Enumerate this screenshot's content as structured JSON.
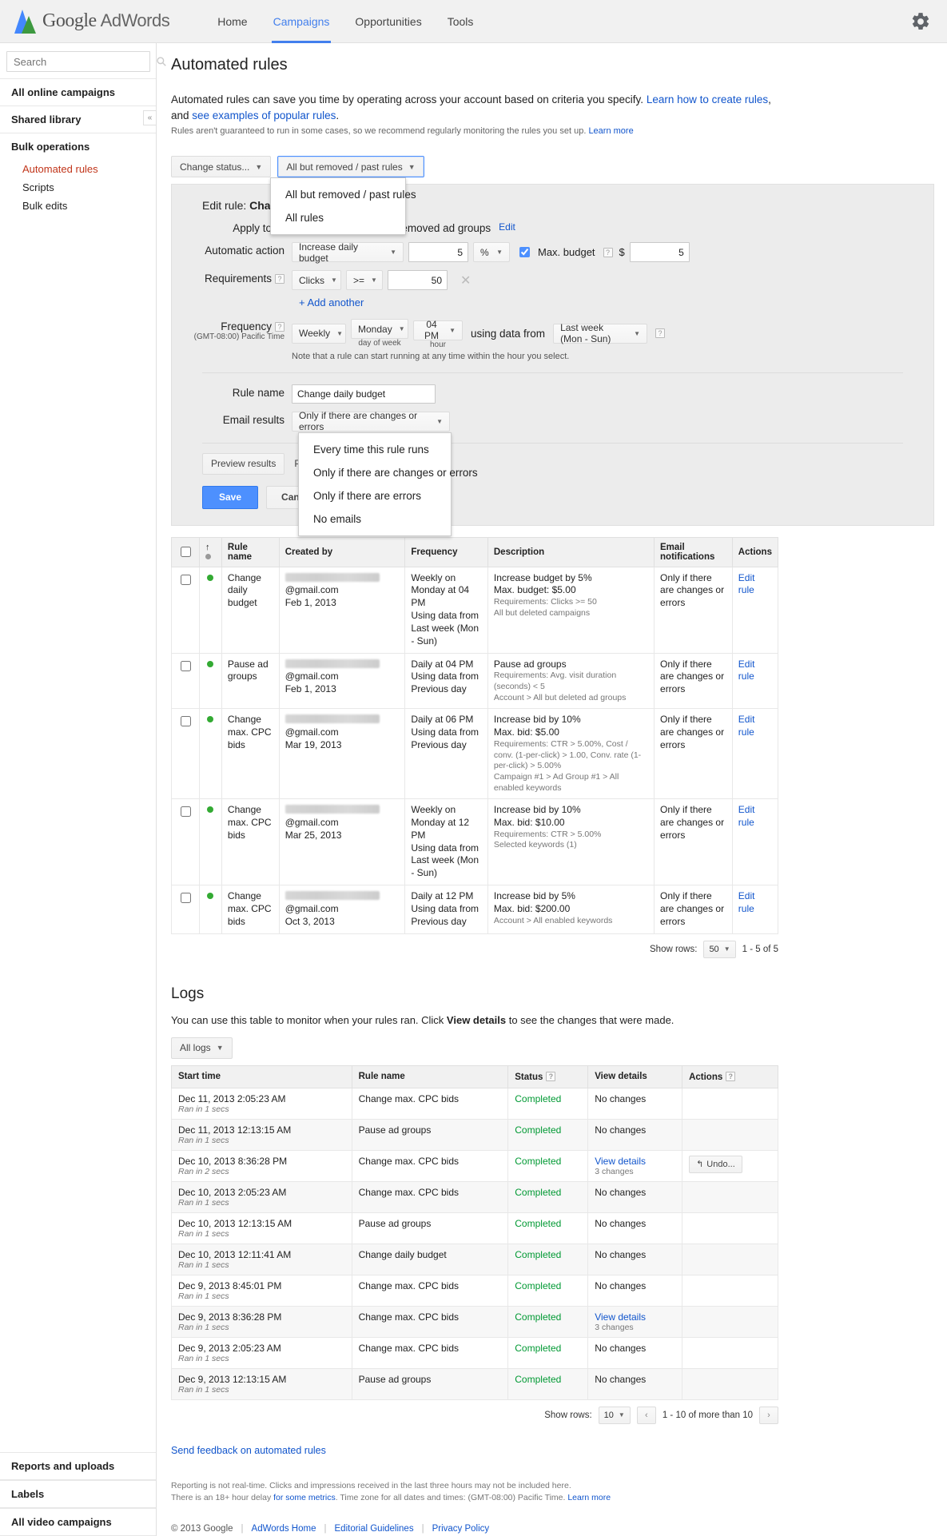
{
  "topnav": {
    "brand_google": "Google",
    "brand_product": "AdWords",
    "links": [
      {
        "label": "Home",
        "active": false
      },
      {
        "label": "Campaigns",
        "active": true
      },
      {
        "label": "Opportunities",
        "active": false
      },
      {
        "label": "Tools",
        "active": false
      }
    ],
    "settings_icon": "gear-icon"
  },
  "sidebar": {
    "search_placeholder": "Search",
    "sections": [
      {
        "label": "All online campaigns"
      },
      {
        "label": "Shared library"
      },
      {
        "label": "Bulk operations"
      }
    ],
    "bulk_items": [
      {
        "label": "Automated rules",
        "active": true
      },
      {
        "label": "Scripts",
        "active": false
      },
      {
        "label": "Bulk edits",
        "active": false
      }
    ],
    "bottom_sections": [
      {
        "label": "Reports and uploads"
      },
      {
        "label": "Labels"
      },
      {
        "label": "All video campaigns"
      }
    ],
    "collapse_label": "«"
  },
  "page": {
    "title": "Automated rules",
    "intro_1": "Automated rules can save you time by operating across your account based on criteria you specify. ",
    "intro_link_1": "Learn how to create rules",
    "intro_2": ", and ",
    "intro_link_2": "see examples of popular rules",
    "intro_3": ".",
    "intro_sub": "Rules aren't guaranteed to run in some cases, so we recommend regularly monitoring the rules you set up. ",
    "intro_sub_link": "Learn more"
  },
  "toolbar": {
    "change_status": "Change status...",
    "filter_selected": "All but removed / past rules",
    "filter_options": [
      "All but removed / past rules",
      "All rules"
    ]
  },
  "edit_rule": {
    "heading_prefix": "Edit rule: ",
    "heading_name": "Change daily budget",
    "apply_to_label": "Apply to",
    "apply_to_value": "Campaign #7 › All but removed ad groups",
    "apply_to_edit": "Edit",
    "action_label": "Automatic action",
    "action_value": "Increase daily budget",
    "action_amount": "5",
    "action_unit": "%",
    "max_budget_label": "Max. budget",
    "max_budget_currency": "$",
    "max_budget_value": "5",
    "requirements_label": "Requirements",
    "req_metric": "Clicks",
    "req_operator": ">=",
    "req_value": "50",
    "add_another": "+ Add another",
    "frequency_label": "Frequency",
    "frequency_tz": "(GMT-08:00) Pacific Time",
    "freq_interval": "Weekly",
    "freq_day": "Monday",
    "freq_hour": "04 PM",
    "freq_day_sub": "day of week",
    "freq_hour_sub": "hour",
    "using_data_from_label": "using data from",
    "using_data_from_value": "Last week (Mon - Sun)",
    "freq_note": "Note that a rule can start running at any time within the hour you select.",
    "rule_name_label": "Rule name",
    "rule_name_value": "Change daily budget",
    "email_results_label": "Email results",
    "email_results_value": "Only if there are changes or errors",
    "email_options": [
      "Every time this rule runs",
      "Only if there are changes or errors",
      "Only if there are errors",
      "No emails"
    ],
    "preview_results": "Preview results",
    "preview_other": "Previ",
    "save": "Save",
    "cancel": "Cancel"
  },
  "rules_table": {
    "headers": [
      "",
      "",
      "Rule name",
      "Created by",
      "Frequency",
      "Description",
      "Email notifications",
      "Actions"
    ],
    "rows": [
      {
        "status": "enabled",
        "rule_name": "Change daily budget",
        "created_by_email": "@gmail.com",
        "created_by_date": "Feb 1, 2013",
        "frequency": "Weekly on Monday at 04 PM\nUsing data from Last week (Mon - Sun)",
        "desc_main": "Increase budget by 5%\nMax. budget: $5.00",
        "desc_small": "Requirements: Clicks >= 50\nAll but deleted campaigns",
        "email": "Only if there are changes or errors",
        "action": "Edit rule"
      },
      {
        "status": "enabled",
        "rule_name": "Pause ad groups",
        "created_by_email": "@gmail.com",
        "created_by_date": "Feb 1, 2013",
        "frequency": "Daily at 04 PM\nUsing data from Previous day",
        "desc_main": "Pause ad groups",
        "desc_small": "Requirements: Avg. visit duration (seconds) < 5\nAccount > All but deleted ad groups",
        "email": "Only if there are changes or errors",
        "action": "Edit rule"
      },
      {
        "status": "enabled",
        "rule_name": "Change max. CPC bids",
        "created_by_email": "@gmail.com",
        "created_by_date": "Mar 19, 2013",
        "frequency": "Daily at 06 PM\nUsing data from Previous day",
        "desc_main": "Increase bid by 10%\nMax. bid: $5.00",
        "desc_small": "Requirements: CTR > 5.00%, Cost / conv. (1-per-click) > 1.00, Conv. rate (1-per-click) > 5.00%\nCampaign #1 > Ad Group #1 > All enabled keywords",
        "email": "Only if there are changes or errors",
        "action": "Edit rule"
      },
      {
        "status": "enabled",
        "rule_name": "Change max. CPC bids",
        "created_by_email": "@gmail.com",
        "created_by_date": "Mar 25, 2013",
        "frequency": "Weekly on Monday at 12 PM\nUsing data from Last week (Mon - Sun)",
        "desc_main": "Increase bid by 10%\nMax. bid: $10.00",
        "desc_small": "Requirements: CTR > 5.00%\nSelected keywords (1)",
        "email": "Only if there are changes or errors",
        "action": "Edit rule"
      },
      {
        "status": "enabled",
        "rule_name": "Change max. CPC bids",
        "created_by_email": "@gmail.com",
        "created_by_date": "Oct 3, 2013",
        "frequency": "Daily at 12 PM\nUsing data from Previous day",
        "desc_main": "Increase bid by 5%\nMax. bid: $200.00",
        "desc_small": "Account > All enabled keywords",
        "email": "Only if there are changes or errors",
        "action": "Edit rule"
      }
    ],
    "show_rows_label": "Show rows:",
    "show_rows_value": "50",
    "range": "1 - 5 of 5"
  },
  "logs": {
    "title": "Logs",
    "intro_pre": "You can use this table to monitor when your rules ran. Click ",
    "intro_bold": "View details",
    "intro_post": " to see the changes that were made.",
    "filter": "All logs",
    "headers": [
      "Start time",
      "Rule name",
      "Status",
      "View details",
      "Actions"
    ],
    "rows": [
      {
        "start_time": "Dec 11, 2013 2:05:23 AM",
        "ran": "Ran in 1 secs",
        "rule_name": "Change max. CPC bids",
        "status": "Completed",
        "details": "No changes",
        "details_sub": "",
        "action": ""
      },
      {
        "start_time": "Dec 11, 2013 12:13:15 AM",
        "ran": "Ran in 1 secs",
        "rule_name": "Pause ad groups",
        "status": "Completed",
        "details": "No changes",
        "details_sub": "",
        "action": ""
      },
      {
        "start_time": "Dec 10, 2013 8:36:28 PM",
        "ran": "Ran in 2 secs",
        "rule_name": "Change max. CPC bids",
        "status": "Completed",
        "details": "View details",
        "details_sub": "3 changes",
        "action": "Undo..."
      },
      {
        "start_time": "Dec 10, 2013 2:05:23 AM",
        "ran": "Ran in 1 secs",
        "rule_name": "Change max. CPC bids",
        "status": "Completed",
        "details": "No changes",
        "details_sub": "",
        "action": ""
      },
      {
        "start_time": "Dec 10, 2013 12:13:15 AM",
        "ran": "Ran in 1 secs",
        "rule_name": "Pause ad groups",
        "status": "Completed",
        "details": "No changes",
        "details_sub": "",
        "action": ""
      },
      {
        "start_time": "Dec 10, 2013 12:11:41 AM",
        "ran": "Ran in 1 secs",
        "rule_name": "Change daily budget",
        "status": "Completed",
        "details": "No changes",
        "details_sub": "",
        "action": ""
      },
      {
        "start_time": "Dec 9, 2013 8:45:01 PM",
        "ran": "Ran in 1 secs",
        "rule_name": "Change max. CPC bids",
        "status": "Completed",
        "details": "No changes",
        "details_sub": "",
        "action": ""
      },
      {
        "start_time": "Dec 9, 2013 8:36:28 PM",
        "ran": "Ran in 1 secs",
        "rule_name": "Change max. CPC bids",
        "status": "Completed",
        "details": "View details",
        "details_sub": "3 changes",
        "action": ""
      },
      {
        "start_time": "Dec 9, 2013 2:05:23 AM",
        "ran": "Ran in 1 secs",
        "rule_name": "Change max. CPC bids",
        "status": "Completed",
        "details": "No changes",
        "details_sub": "",
        "action": ""
      },
      {
        "start_time": "Dec 9, 2013 12:13:15 AM",
        "ran": "Ran in 1 secs",
        "rule_name": "Pause ad groups",
        "status": "Completed",
        "details": "No changes",
        "details_sub": "",
        "action": ""
      }
    ],
    "show_rows_label": "Show rows:",
    "show_rows_value": "10",
    "range": "1 - 10 of more than 10"
  },
  "footer": {
    "feedback": "Send feedback on automated rules",
    "note_1": "Reporting is not real-time. Clicks and impressions received in the last three hours may not be included here.",
    "note_2_pre": "There is an 18+ hour delay ",
    "note_2_link": "for some metrics",
    "note_2_post": ". Time zone for all dates and times: (GMT-08:00) Pacific Time. ",
    "note_2_learn": "Learn more",
    "copyright": "© 2013 Google",
    "links": [
      "AdWords Home",
      "Editorial Guidelines",
      "Privacy Policy"
    ]
  },
  "colors": {
    "accent_blue": "#427fed",
    "link_blue": "#15c",
    "active_red": "#c1351a",
    "status_green": "#093",
    "dot_green": "#3a3"
  }
}
